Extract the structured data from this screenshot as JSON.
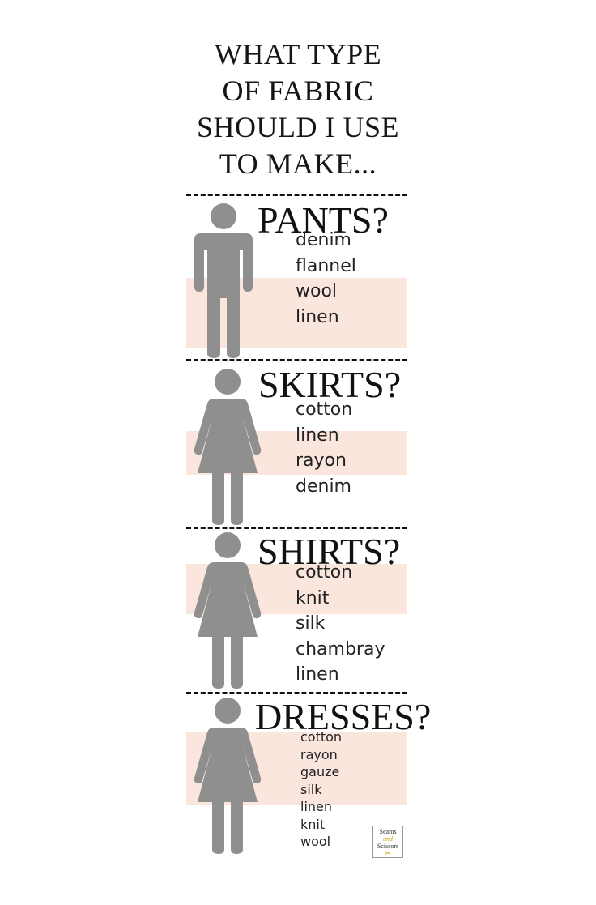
{
  "title": {
    "lines": [
      "WHAT TYPE",
      "OF FABRIC",
      "SHOULD I USE",
      "TO MAKE..."
    ]
  },
  "sections": [
    {
      "heading": "PANTS?",
      "figure": "man-icon",
      "fabrics": [
        "denim",
        "flannel",
        "wool",
        "linen"
      ]
    },
    {
      "heading": "SKIRTS?",
      "figure": "woman-icon",
      "fabrics": [
        "cotton",
        "linen",
        "rayon",
        "denim"
      ]
    },
    {
      "heading": "SHIRTS?",
      "figure": "woman-icon",
      "fabrics": [
        "cotton",
        "knit",
        "silk",
        "chambray",
        "linen"
      ]
    },
    {
      "heading": "DRESSES?",
      "figure": "woman-icon",
      "fabrics": [
        "cotton",
        "rayon",
        "gauze",
        "silk",
        "linen",
        "knit",
        "wool"
      ]
    }
  ],
  "logo": {
    "line1": "Seams",
    "line2": "and",
    "line3": "Scissors"
  },
  "colors": {
    "highlight": "#f9e2d6",
    "figure": "#8f8f8f",
    "text": "#111111"
  }
}
